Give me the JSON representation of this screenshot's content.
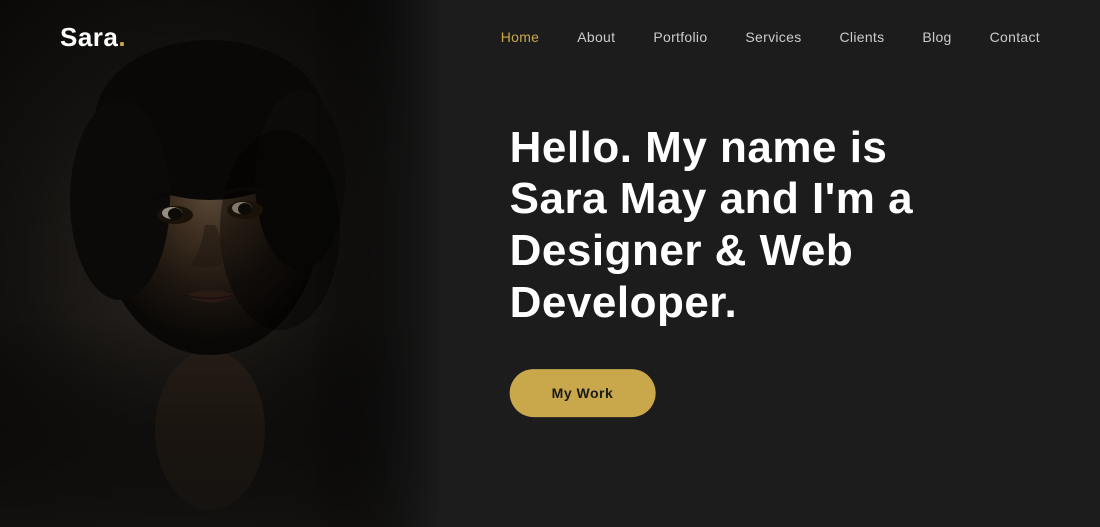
{
  "site": {
    "logo_text": "Sara",
    "logo_dot": ".",
    "accent_color": "#c9a84c",
    "bg_color": "#1c1c1c"
  },
  "navbar": {
    "links": [
      {
        "label": "Home",
        "active": true
      },
      {
        "label": "About",
        "active": false
      },
      {
        "label": "Portfolio",
        "active": false
      },
      {
        "label": "Services",
        "active": false
      },
      {
        "label": "Clients",
        "active": false
      },
      {
        "label": "Blog",
        "active": false
      },
      {
        "label": "Contact",
        "active": false
      }
    ]
  },
  "hero": {
    "heading_line1": "Hello. My name is",
    "heading_line2": "Sara May and I'm a",
    "heading_line3": "Designer & Web",
    "heading_line4": "Developer.",
    "cta_label": "My Work"
  }
}
